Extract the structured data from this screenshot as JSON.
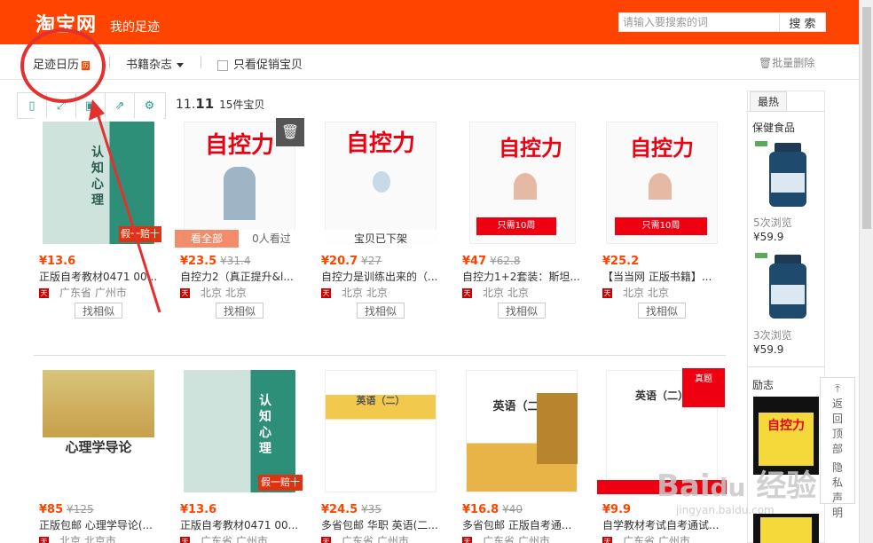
{
  "header": {
    "logo": "淘宝网",
    "subtitle": "我的足迹",
    "search_placeholder": "请输入要搜索的词",
    "search_button": "搜 索"
  },
  "filters": {
    "calendar": "足迹日历",
    "calendar_badge": "历",
    "category": "书籍杂志",
    "promo_only": "只看促销宝贝",
    "bulk_delete": "批量删除"
  },
  "date_group": {
    "date_prefix": "11.",
    "date_day": "11",
    "count": "15件宝贝"
  },
  "row1": [
    {
      "price": "¥13.6",
      "old": "",
      "name": "正版自考教材0471 00...",
      "loc": "广东省 广州市",
      "similar": "找相似",
      "book_title": "认知心理"
    },
    {
      "price": "¥23.5",
      "old": "¥31.4",
      "name": "自控力2（真正提升&l...",
      "loc": "北京 北京",
      "similar": "找相似",
      "book_title": "自控力",
      "overlay_left": "看全部",
      "overlay_right": "0人看过"
    },
    {
      "price": "¥20.7",
      "old": "¥27",
      "name": "自控力是训练出来的（...",
      "loc": "北京 北京",
      "similar": "找相似",
      "book_title": "自控力",
      "overlay_full": "宝贝已下架"
    },
    {
      "price": "¥47",
      "old": "¥62.8",
      "name": "自控力1+2套装：斯坦...",
      "loc": "北京 北京",
      "similar": "找相似",
      "book_title": "自控力"
    },
    {
      "price": "¥25.2",
      "old": "",
      "name": "【当当网 正版书籍】...",
      "loc": "北京 北京",
      "similar": "找相似",
      "book_title": "自控力"
    }
  ],
  "row2": [
    {
      "price": "¥85",
      "old": "¥125",
      "name": "正版包邮 心理学导论(...",
      "loc": "北京 北京市",
      "book_title": "心理学导论"
    },
    {
      "price": "¥13.6",
      "old": "",
      "name": "正版自考教材0471 00...",
      "loc": "广东省 广州市",
      "book_title": "认知心理"
    },
    {
      "price": "¥24.5",
      "old": "¥35",
      "name": "多省包邮 华职 英语(二...",
      "loc": "广东省 广州市",
      "book_title": "英语（二）"
    },
    {
      "price": "¥16.8",
      "old": "¥40",
      "name": "多省包邮 正版自考通...",
      "loc": "广东省 广州市",
      "book_title": "英语（二）"
    },
    {
      "price": "¥9.9",
      "old": "",
      "name": "自学教材考试自考通试...",
      "loc": "广东省 广州市",
      "book_title": "英语（二）"
    }
  ],
  "sidebar": {
    "tab": "最热",
    "cat1": "保健食品",
    "item1_views": "5次浏览",
    "item1_price": "¥59.9",
    "item2_views": "3次浏览",
    "item2_price": "¥59.9",
    "cat2": "励志",
    "cat2_book": "自控力"
  },
  "backtop": {
    "label": "返回顶部",
    "feedback": "隐私声明"
  },
  "colors": {
    "brand": "#ff4400",
    "price": "#ff4400"
  }
}
